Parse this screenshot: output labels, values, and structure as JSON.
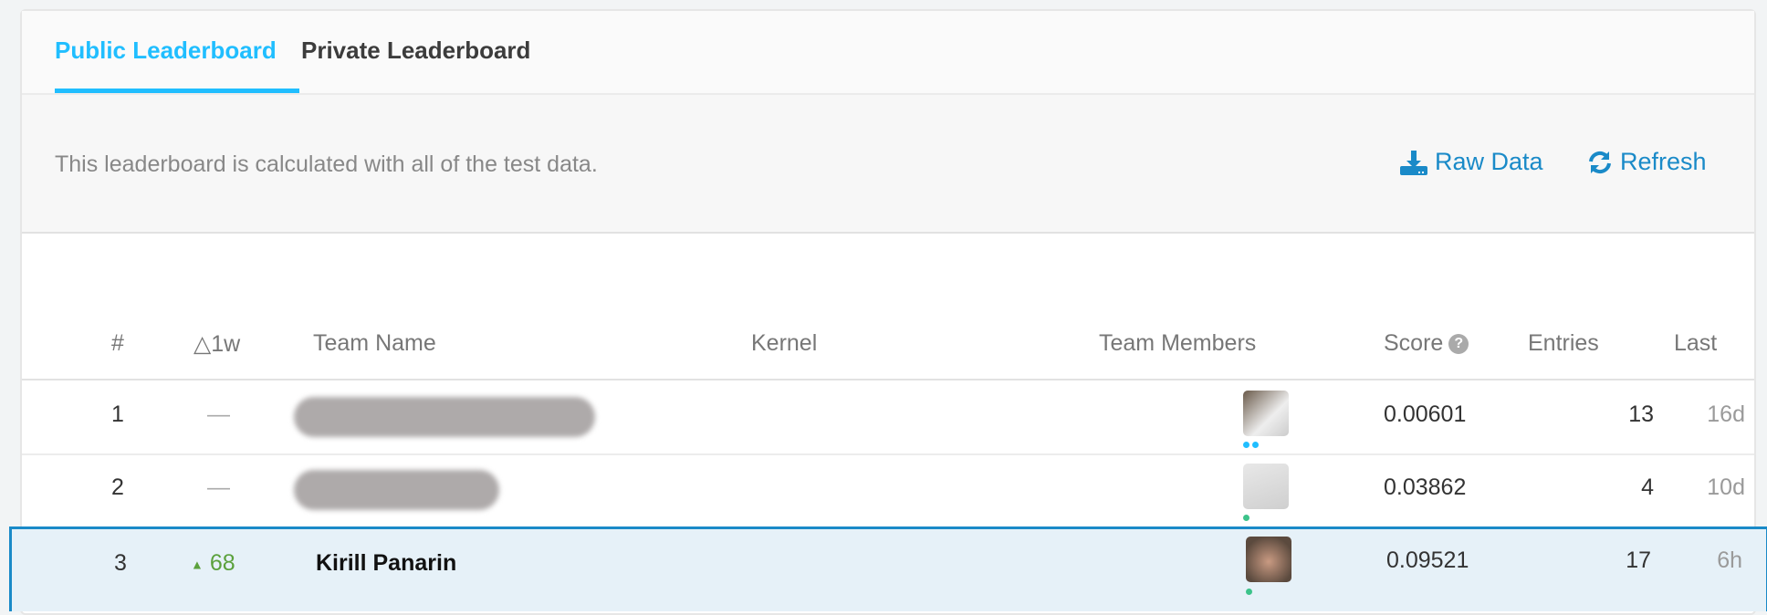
{
  "tabs": [
    {
      "label": "Public Leaderboard",
      "active": true
    },
    {
      "label": "Private Leaderboard",
      "active": false
    }
  ],
  "info": {
    "text": "This leaderboard is calculated with all of the test data.",
    "raw_data": "Raw Data",
    "refresh": "Refresh"
  },
  "columns": {
    "rank": "#",
    "delta": "△1w",
    "team_name": "Team Name",
    "kernel": "Kernel",
    "team_members": "Team Members",
    "score": "Score",
    "entries": "Entries",
    "last": "Last"
  },
  "rows": [
    {
      "rank": "1",
      "delta": "—",
      "team_name": "",
      "score": "0.00601",
      "entries": "13",
      "last": "16d",
      "team_name_redacted": true
    },
    {
      "rank": "2",
      "delta": "—",
      "team_name": "",
      "score": "0.03862",
      "entries": "4",
      "last": "10d",
      "team_name_redacted": true
    },
    {
      "rank": "3",
      "delta": "68",
      "delta_direction": "up",
      "team_name": "Kirill Panarin",
      "score": "0.09521",
      "entries": "17",
      "last": "6h",
      "highlighted": true
    }
  ],
  "colors": {
    "accent": "#20beff",
    "link": "#1a8ac8",
    "up": "#5ba13c",
    "highlight_bg": "#e6f1f8"
  }
}
